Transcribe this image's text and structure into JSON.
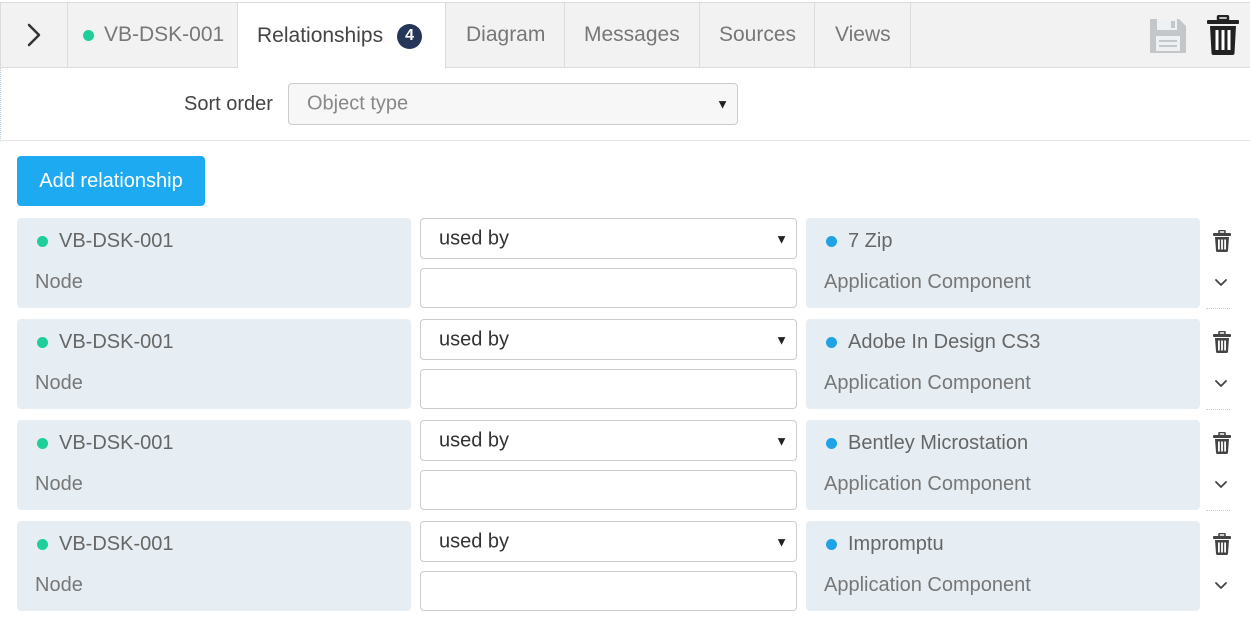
{
  "tabs": {
    "element": {
      "label": "VB-DSK-001"
    },
    "relationships": {
      "label": "Relationships",
      "count": "4"
    },
    "diagram": {
      "label": "Diagram"
    },
    "messages": {
      "label": "Messages"
    },
    "sources": {
      "label": "Sources"
    },
    "views": {
      "label": "Views"
    }
  },
  "icons": {
    "toggle": "chevron-right-icon",
    "save": "save-icon",
    "delete": "trash-icon",
    "row_delete": "trash-icon",
    "row_expand": "chevron-down-icon"
  },
  "sort": {
    "label": "Sort order",
    "value": "Object type"
  },
  "add_button": {
    "label": "Add relationship"
  },
  "colors": {
    "node_dot": "#1ecf9a",
    "component_dot": "#1fa3e6",
    "primary_button": "#1eaaf1",
    "badge": "#25365a"
  },
  "relationships": [
    {
      "source": "VB-DSK-001",
      "source_type": "Node",
      "relation": "used by",
      "label_value": "",
      "target": "7 Zip",
      "target_type": "Application Component"
    },
    {
      "source": "VB-DSK-001",
      "source_type": "Node",
      "relation": "used by",
      "label_value": "",
      "target": "Adobe In Design CS3",
      "target_type": "Application Component"
    },
    {
      "source": "VB-DSK-001",
      "source_type": "Node",
      "relation": "used by",
      "label_value": "",
      "target": "Bentley Microstation",
      "target_type": "Application Component"
    },
    {
      "source": "VB-DSK-001",
      "source_type": "Node",
      "relation": "used by",
      "label_value": "",
      "target": "Impromptu",
      "target_type": "Application Component"
    }
  ]
}
